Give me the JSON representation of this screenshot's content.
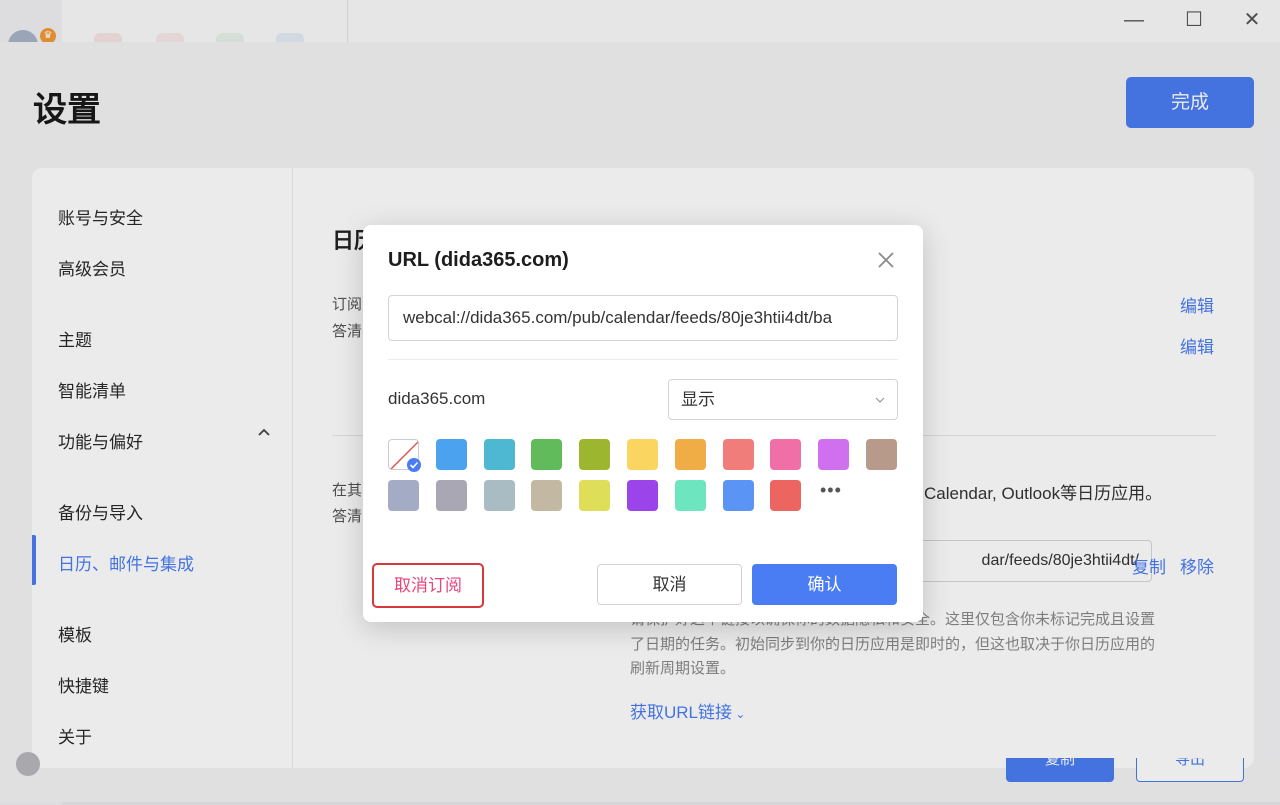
{
  "window": {
    "controls": {
      "minimize": "—",
      "maximize": "☐",
      "close": "✕"
    }
  },
  "header": {
    "title": "设置",
    "done_label": "完成"
  },
  "sidebar": {
    "items": [
      {
        "label": "账号与安全"
      },
      {
        "label": "高级会员"
      },
      {
        "label": "主题"
      },
      {
        "label": "智能清单"
      },
      {
        "label": "功能与偏好"
      },
      {
        "label": "备份与导入"
      },
      {
        "label": "日历、邮件与集成",
        "active": true
      },
      {
        "label": "模板"
      },
      {
        "label": "快捷键"
      },
      {
        "label": "关于"
      }
    ]
  },
  "content": {
    "title_fragment": "日历",
    "row1_text_a": "订阅",
    "row1_text_b": "答清",
    "edit_label_1": "编辑",
    "edit_label_2": "编辑",
    "row2_text_a": "在其",
    "row2_text_b": "答清",
    "row2_tail": "Calendar, Outlook等日历应用。",
    "feed_url_tail": "dar/feeds/80je3htii4dt/",
    "copy_label": "复制",
    "remove_label": "移除",
    "desc_line1": "请保护好这个链接以确保你的数据隐私和安全。这里仅包含你未标记完成且设置",
    "desc_line2": "了日期的任务。初始同步到你的日历应用是即时的，但这也取决于你日历应用的",
    "desc_line3": "刷新周期设置。",
    "get_url_label": "获取URL链接",
    "bottom_btn_a": "复制",
    "bottom_btn_b": "导出"
  },
  "dialog": {
    "title": "URL (dida365.com)",
    "url_value": "webcal://dida365.com/pub/calendar/feeds/80je3htii4dt/ba",
    "source_name": "dida365.com",
    "visibility_value": "显示",
    "more_colors": "•••",
    "unsubscribe_label": "取消订阅",
    "cancel_label": "取消",
    "confirm_label": "确认",
    "colors": {
      "row1": [
        "none",
        "#4ba3ef",
        "#4eb7d1",
        "#62bb5a",
        "#9db62f",
        "#fad560",
        "#f1ad45",
        "#f17d7a",
        "#ef6fa6",
        "#d070ef",
        "#b79a8a"
      ],
      "row2": [
        "#a4acc5",
        "#aaa7b5",
        "#a9bcc3",
        "#c3b9a2",
        "#dede58",
        "#9a44ea",
        "#6de5bf",
        "#5a95f5",
        "#ec6561"
      ]
    }
  },
  "colors": {
    "accent": "#4a7df3",
    "danger_border": "#d9383b",
    "danger_text": "#e8457a"
  }
}
